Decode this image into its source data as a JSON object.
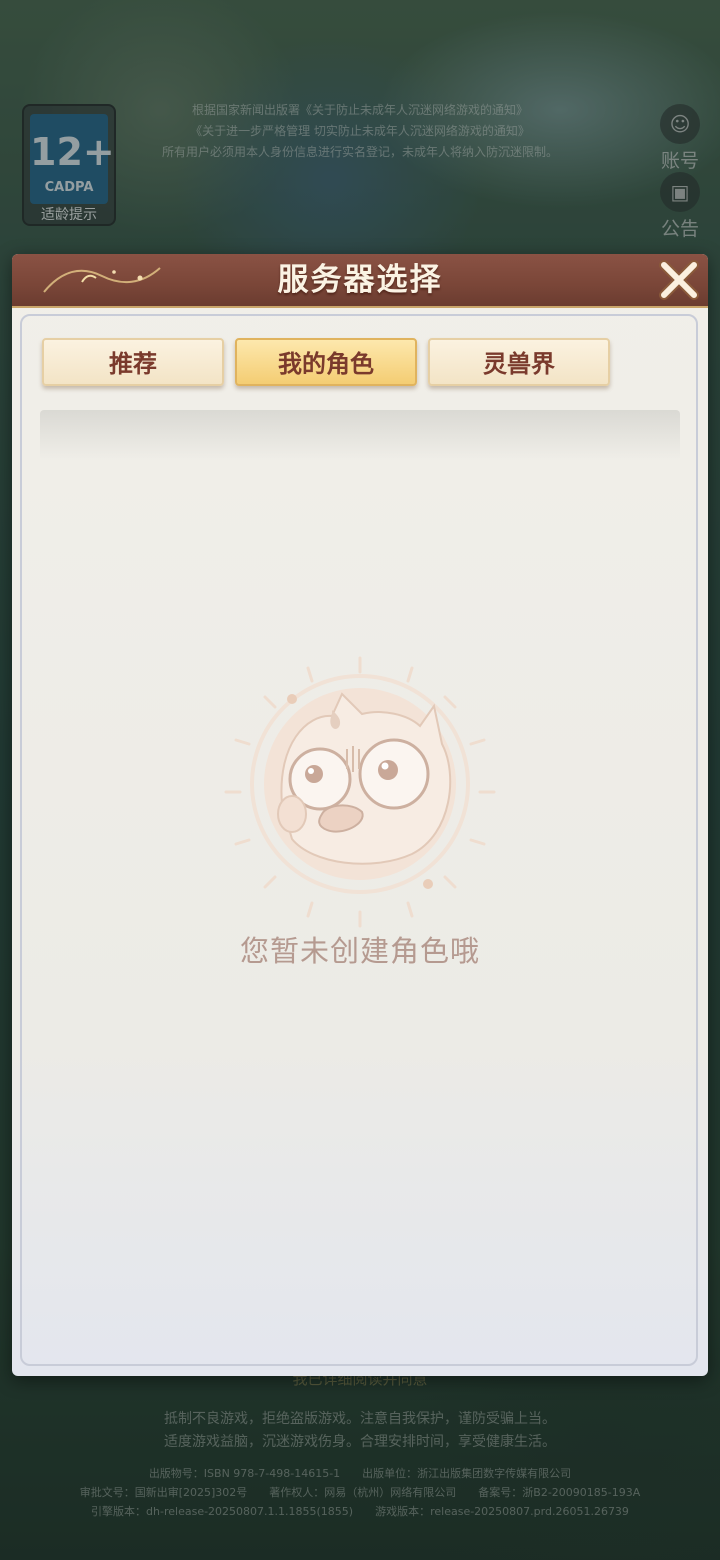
{
  "background": {
    "notice_lines": [
      "根据国家新闻出版署《关于防止未成年人沉迷网络游戏的通知》",
      "《关于进一步严格管理 切实防止未成年人沉迷网络游戏的通知》",
      "所有用户必须用本人身份信息进行实名登记，未成年人将纳入防沉迷限制。"
    ],
    "age_badge": {
      "number": "12+",
      "org": "CADPA",
      "label": "适龄提示"
    },
    "side_buttons": [
      {
        "label": "账号",
        "icon": "account-icon"
      },
      {
        "label": "公告",
        "icon": "announcement-icon"
      }
    ],
    "agreement_line": "我已详细阅读并同意",
    "slogan_lines": [
      "抵制不良游戏，拒绝盗版游戏。注意自我保护，谨防受骗上当。",
      "适度游戏益脑，沉迷游戏伤身。合理安排时间，享受健康生活。"
    ],
    "info_lines": [
      "出版物号：ISBN 978-7-498-14615-1　　出版单位：浙江出版集团数字传媒有限公司",
      "审批文号：国新出审[2025]302号　　著作权人：网易（杭州）网络有限公司　　备案号：浙B2-20090185-193A",
      "引擎版本：dh-release-20250807.1.1.1855(1855)　　游戏版本：release-20250807.prd.26051.26739"
    ]
  },
  "modal": {
    "title": "服务器选择",
    "close_icon": "close-icon",
    "tabs": [
      {
        "label": "推荐",
        "active": false
      },
      {
        "label": "我的角色",
        "active": true
      },
      {
        "label": "灵兽界",
        "active": false
      }
    ],
    "empty_state": {
      "icon": "surprised-cat-icon",
      "message": "您暂未创建角色哦"
    }
  },
  "colors": {
    "header_brown": "#7a4638",
    "tab_text": "#7a3a2c",
    "active_tab": "#f4cd73",
    "empty_text": "#b59a90"
  }
}
